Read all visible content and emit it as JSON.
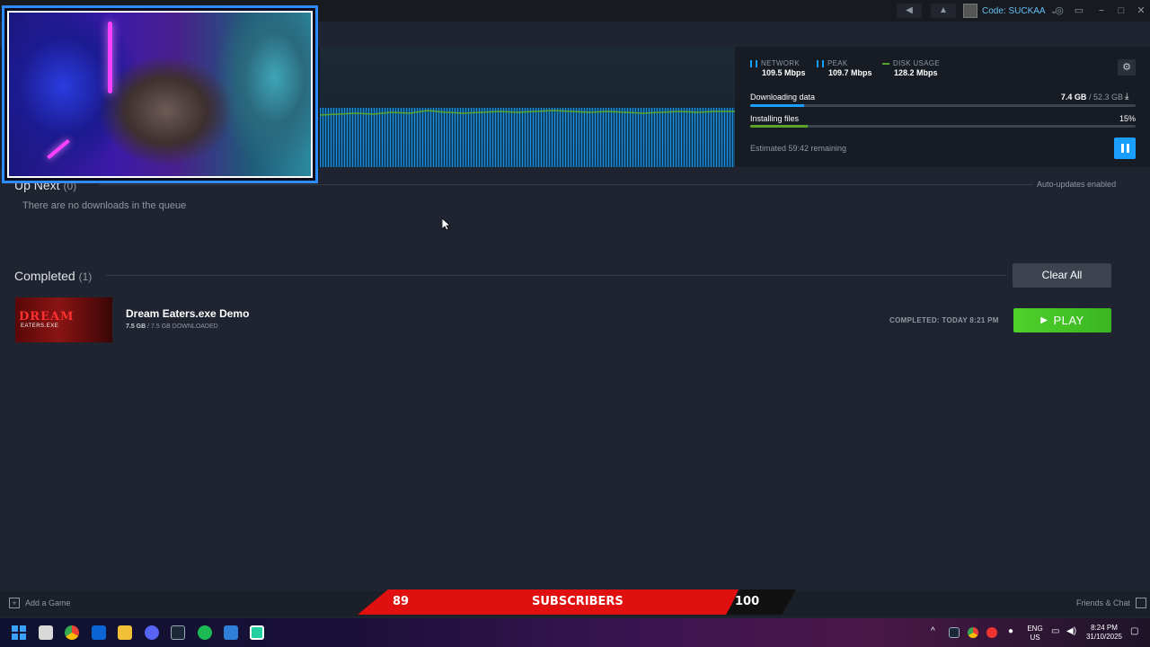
{
  "titlebar": {
    "announce_icon": "megaphone-icon",
    "bell_icon": "bell-icon",
    "user_label": "Code: SUCKAA",
    "controller_icon": "controller-icon",
    "monitor_icon": "monitor-icon"
  },
  "stats": {
    "network_label": "NETWORK",
    "network_value": "109.5 Mbps",
    "peak_label": "PEAK",
    "peak_value": "109.7 Mbps",
    "disk_label": "DISK USAGE",
    "disk_value": "128.2 Mbps"
  },
  "progress": {
    "downloading_label": "Downloading data",
    "downloaded": "7.4 GB",
    "total": "52.3 GB",
    "download_fraction": 0.14,
    "installing_label": "Installing files",
    "installing_percent": "15%",
    "installing_fraction": 0.15,
    "estimate": "Estimated 59:42 remaining"
  },
  "up_next": {
    "title": "Up Next",
    "count": "(0)",
    "empty_text": "There are no downloads in the queue",
    "auto_updates": "Auto-updates enabled"
  },
  "completed": {
    "title": "Completed",
    "count": "(1)",
    "clear_label": "Clear All",
    "items": [
      {
        "name": "Dream Eaters.exe Demo",
        "size_done": "7.5 GB",
        "size_total": "/ 7.5 GB DOWNLOADED",
        "thumb_title": "DREAM",
        "thumb_sub": "EATERS.EXE",
        "status": "COMPLETED: TODAY 8:21 PM",
        "play_label": "PLAY"
      }
    ]
  },
  "bottom": {
    "add_game": "Add a Game",
    "friends_chat": "Friends & Chat"
  },
  "subscribers": {
    "current": "89",
    "label": "SUBSCRIBERS",
    "goal": "100"
  },
  "taskbar": {
    "lang_top": "ENG",
    "lang_bottom": "US",
    "time": "8:24 PM",
    "date": "31/10/2025"
  },
  "colors": {
    "accent": "#1a9fff",
    "play_green": "#4fd12b",
    "subs_red": "#e01010"
  }
}
